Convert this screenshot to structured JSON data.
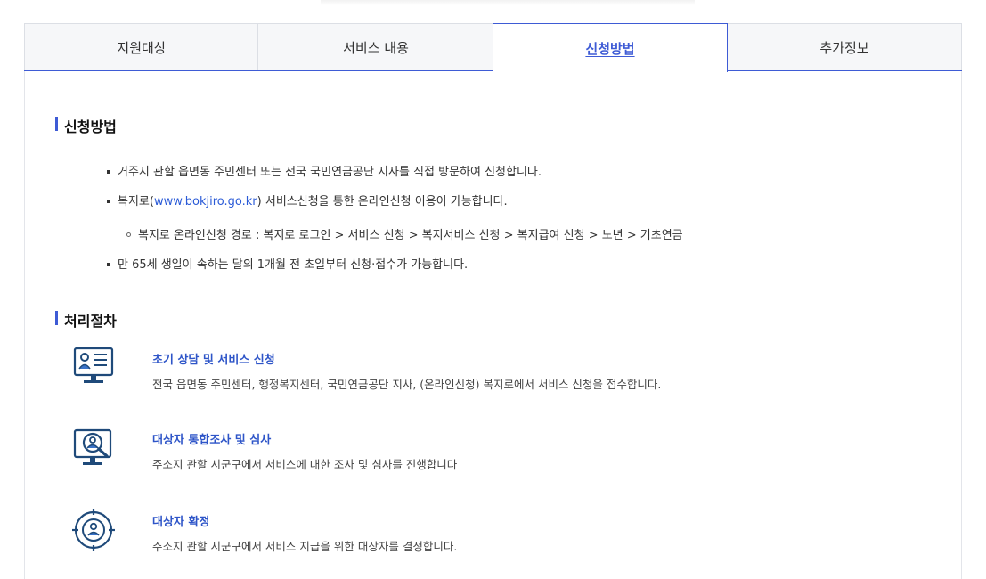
{
  "tabs": [
    {
      "label": "지원대상"
    },
    {
      "label": "서비스 내용"
    },
    {
      "label": "신청방법"
    },
    {
      "label": "추가정보"
    }
  ],
  "apply": {
    "title": "신청방법",
    "bullet1": "거주지 관할 읍면동 주민센터 또는 전국 국민연금공단 지사를 직접 방문하여 신청합니다.",
    "bullet2_prefix": "복지로(",
    "bullet2_link": "www.bokjiro.go.kr",
    "bullet2_suffix": ") 서비스신청을 통한 온라인신청 이용이 가능합니다.",
    "sub_bullet": "복지로 온라인신청 경로 : 복지로 로그인 > 서비스 신청 > 복지서비스 신청 > 복지급여 신청 > 노년 > 기초연금",
    "bullet3": "만 65세 생일이 속하는 달의 1개월 전 초일부터 신청·접수가 가능합니다."
  },
  "process": {
    "title": "처리절차",
    "steps": [
      {
        "icon": "consultation-monitor-icon",
        "title": "초기 상담 및 서비스 신청",
        "desc": "전국 읍면동 주민센터, 행정복지센터, 국민연금공단 지사, (온라인신청) 복지로에서 서비스 신청을 접수합니다."
      },
      {
        "icon": "investigation-magnifier-icon",
        "title": "대상자 통합조사 및 심사",
        "desc": "주소지 관할 시군구에서 서비스에 대한 조사 및 심사를 진행합니다"
      },
      {
        "icon": "target-person-icon",
        "title": "대상자 확정",
        "desc": "주소지 관할 시군구에서 서비스 지급을 위한 대상자를 결정합니다."
      }
    ]
  },
  "colors": {
    "accent": "#3e5bd5",
    "icon": "#1f4a7a",
    "link": "#2b5bd7"
  }
}
